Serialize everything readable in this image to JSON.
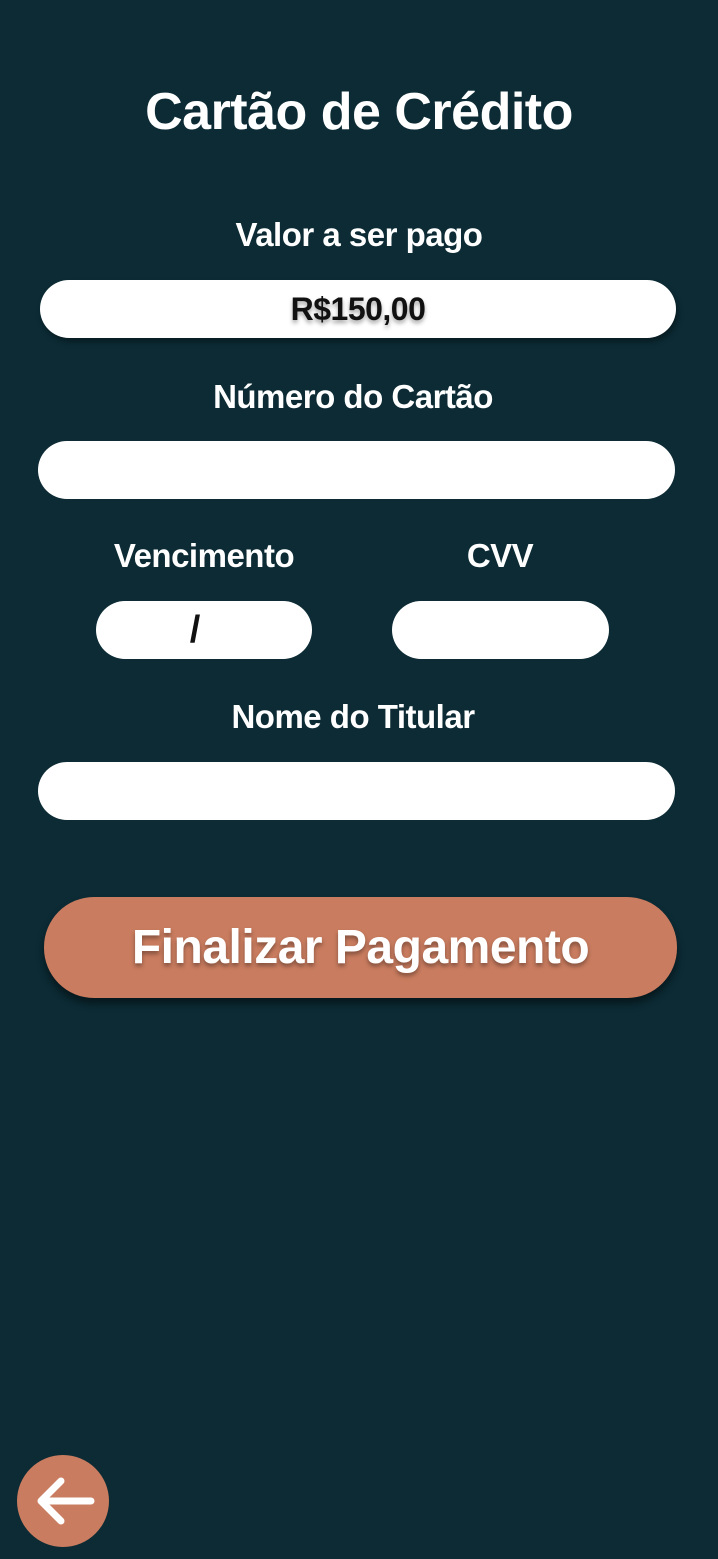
{
  "page": {
    "title": "Cartão de Crédito"
  },
  "form": {
    "amount_label": "Valor a ser pago",
    "amount_value": "R$150,00",
    "card_number_label": "Número do Cartão",
    "card_number_value": "",
    "expiry_label": "Vencimento",
    "expiry_separator": "/",
    "cvv_label": "CVV",
    "cvv_value": "",
    "holder_name_label": "Nome do Titular",
    "holder_name_value": ""
  },
  "actions": {
    "finalize_label": "Finalizar Pagamento",
    "back_icon": "arrow-left-icon"
  },
  "colors": {
    "background": "#0c2b35",
    "accent": "#c97c5f",
    "field": "#ffffff"
  }
}
